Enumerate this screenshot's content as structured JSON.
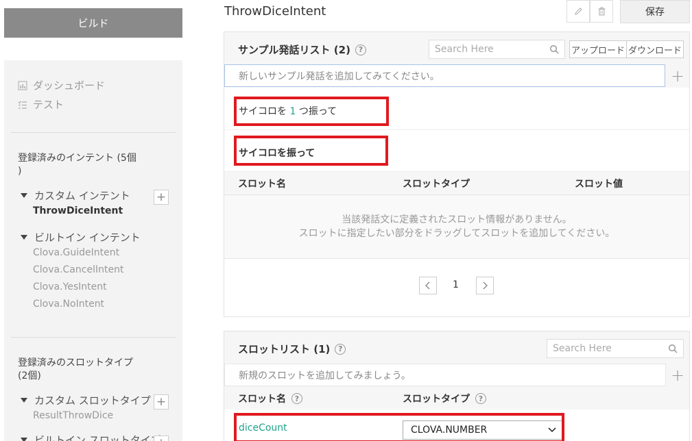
{
  "sidebar": {
    "build_label": "ビルド",
    "nav": [
      {
        "label": "ダッシュボード",
        "icon": "chart-icon"
      },
      {
        "label": "テスト",
        "icon": "checklist-icon"
      }
    ],
    "intents_title": "登録済みのインテント (5個\n)",
    "custom_intent_label": "カスタム インテント",
    "custom_intents": [
      "ThrowDiceIntent"
    ],
    "builtin_intent_label": "ビルトイン インテント",
    "builtin_intents": [
      "Clova.GuideIntent",
      "Clova.CancelIntent",
      "Clova.YesIntent",
      "Clova.NoIntent"
    ],
    "slot_types_title": "登録済みのスロットタイプ\n(2個)",
    "custom_slot_type_label": "カスタム スロットタイプ",
    "custom_slot_types": [
      "ResultThrowDice"
    ],
    "builtin_slot_type_label": "ビルトイン スロットタイプ"
  },
  "header": {
    "title": "ThrowDiceIntent",
    "save_label": "保存"
  },
  "utterances": {
    "title": "サンプル発話リスト (2)",
    "search_placeholder": "Search Here",
    "upload_label": "アップロード",
    "download_label": "ダウンロード",
    "add_placeholder": "新しいサンプル発話を追加してみてください。",
    "items": [
      {
        "pre": "サイコロを ",
        "num": "1",
        "post": " つ振って"
      },
      {
        "pre": "サイコロを振って",
        "num": "",
        "post": ""
      }
    ],
    "columns": [
      "スロット名",
      "スロットタイプ",
      "スロット値"
    ],
    "empty_line1": "当該発話文に定義されたスロット情報がありません。",
    "empty_line2": "スロットに指定したい部分をドラッグしてスロットを追加してください。",
    "page": "1"
  },
  "slots": {
    "title": "スロットリスト (1)",
    "search_placeholder": "Search Here",
    "add_placeholder": "新規のスロットを追加してみましょう。",
    "col_name": "スロット名",
    "col_type": "スロットタイプ",
    "items": [
      {
        "name": "diceCount",
        "type": "CLOVA.NUMBER"
      }
    ]
  },
  "colors": {
    "highlight": "#e0191f",
    "accent_green": "#1fa38b"
  }
}
